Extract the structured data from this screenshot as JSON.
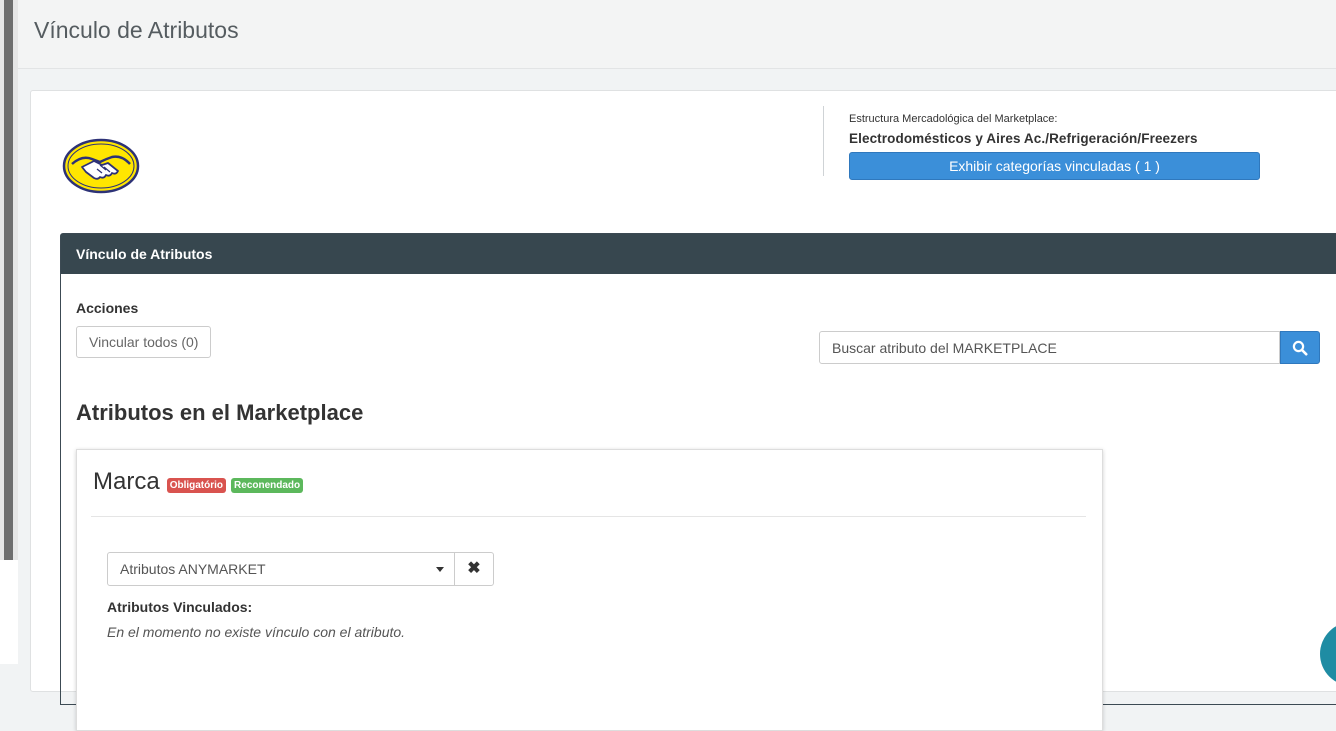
{
  "page": {
    "title": "Vínculo de Atributos"
  },
  "marketplace": {
    "logo_icon": "mercadolibre-handshake-logo",
    "structure_label": "Estructura Mercadológica del Marketplace:",
    "category_path": "Electrodomésticos y Aires Ac./Refrigeración/Freezers",
    "show_categories_button": "Exhibir categorías vinculadas ( 1 )"
  },
  "panel": {
    "title": "Vínculo de Atributos",
    "actions_label": "Acciones",
    "link_all_button": "Vincular todos (0)",
    "search": {
      "placeholder": "Buscar atributo del MARKETPLACE",
      "value": "",
      "icon": "search-icon"
    },
    "section_title": "Atributos en el Marketplace"
  },
  "attributes": [
    {
      "name": "Marca",
      "badges": [
        {
          "label": "Obligatório",
          "color": "#d9534f"
        },
        {
          "label": "Reconendado",
          "color": "#5cb85c"
        }
      ],
      "select_placeholder": "Atributos ANYMARKET",
      "linked_label": "Atributos Vinculados:",
      "linked_message": "En el momento no existe vínculo con el atributo."
    }
  ],
  "colors": {
    "primary": "#3b8fd9",
    "panel_header": "#37474f",
    "fab": "#1f8ca3"
  }
}
